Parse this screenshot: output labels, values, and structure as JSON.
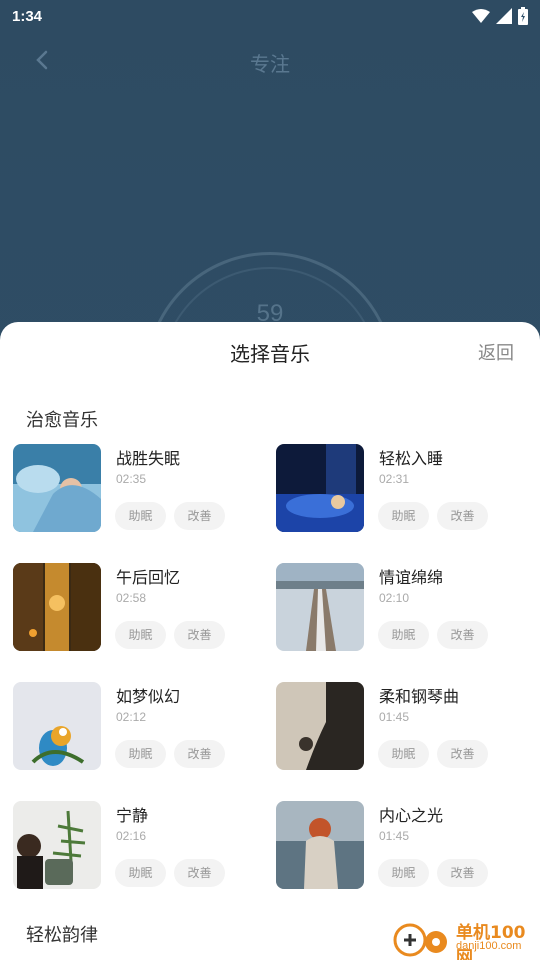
{
  "status_bar": {
    "time": "1:34"
  },
  "background": {
    "title": "专注",
    "timer_value": "59"
  },
  "sheet": {
    "title": "选择音乐",
    "back_label": "返回",
    "sections": [
      {
        "title": "治愈音乐",
        "tracks": [
          {
            "name": "战胜失眠",
            "duration": "02:35",
            "tags": [
              "助眠",
              "改善"
            ],
            "thumb": "bed-blue"
          },
          {
            "name": "轻松入睡",
            "duration": "02:31",
            "tags": [
              "助眠",
              "改善"
            ],
            "thumb": "night-sleep"
          },
          {
            "name": "午后回忆",
            "duration": "02:58",
            "tags": [
              "助眠",
              "改善"
            ],
            "thumb": "alley-lights"
          },
          {
            "name": "情谊绵绵",
            "duration": "02:10",
            "tags": [
              "助眠",
              "改善"
            ],
            "thumb": "snow-road"
          },
          {
            "name": "如梦似幻",
            "duration": "02:12",
            "tags": [
              "助眠",
              "改善"
            ],
            "thumb": "parrot"
          },
          {
            "name": "柔和钢琴曲",
            "duration": "01:45",
            "tags": [
              "助眠",
              "改善"
            ],
            "thumb": "silhouette"
          },
          {
            "name": "宁静",
            "duration": "02:16",
            "tags": [
              "助眠",
              "改善"
            ],
            "thumb": "plant"
          },
          {
            "name": "内心之光",
            "duration": "01:45",
            "tags": [
              "助眠",
              "改善"
            ],
            "thumb": "woman-sea"
          }
        ]
      },
      {
        "title": "轻松韵律",
        "tracks": []
      }
    ]
  },
  "watermark": {
    "brand": "单机100网",
    "url": "danji100.com"
  }
}
